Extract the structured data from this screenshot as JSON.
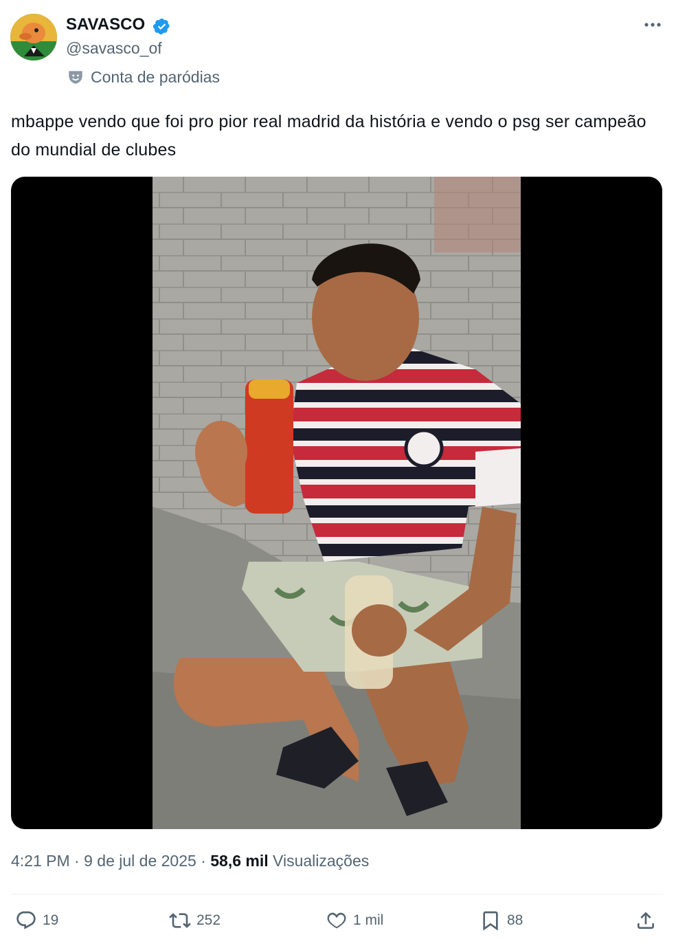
{
  "author": {
    "display_name": "SAVASCO",
    "handle": "@savasco_of",
    "label": "Conta de paródias",
    "verified": true,
    "verified_color": "#1d9bf0"
  },
  "tweet": {
    "text": "mbappe vendo que foi pro pior real madrid da história e vendo o psg ser campeão do mundial de clubes"
  },
  "meta": {
    "time": "4:21 PM",
    "sep1": " · ",
    "date": "9 de jul de 2025",
    "sep2": " · ",
    "views_count": "58,6 mil",
    "views_label": " Visualizações"
  },
  "actions": {
    "replies": "19",
    "reposts": "252",
    "likes": "1 mil",
    "bookmarks": "88"
  },
  "icons": [
    "more-icon",
    "parody-icon",
    "verified-icon",
    "reply-icon",
    "repost-icon",
    "like-icon",
    "bookmark-icon",
    "share-icon"
  ],
  "colors": {
    "text_primary": "#0f1419",
    "text_secondary": "#536471",
    "media_background": "#000000"
  }
}
